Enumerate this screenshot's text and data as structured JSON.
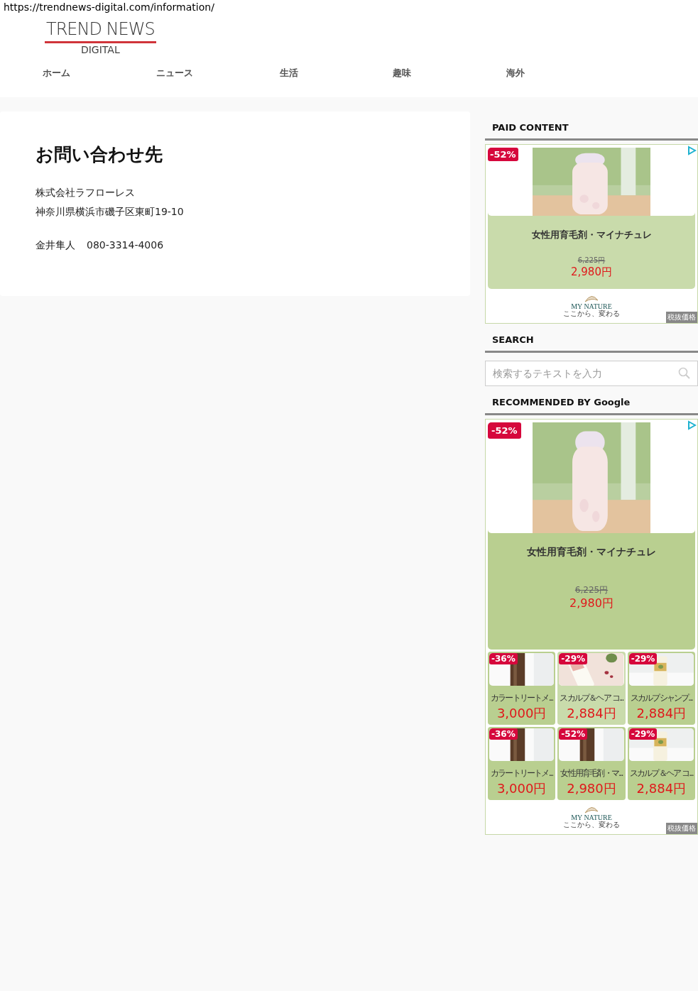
{
  "url": "https://trendnews-digital.com/information/",
  "logo": {
    "title": "TREND NEWS",
    "subtitle": "DIGITAL"
  },
  "nav": [
    {
      "label": "ホーム"
    },
    {
      "label": "ニュース"
    },
    {
      "label": "生活"
    },
    {
      "label": "趣味"
    },
    {
      "label": "海外"
    }
  ],
  "article": {
    "title": "お問い合わせ先",
    "address_lines": [
      "株式会社ラフローレス",
      "神奈川県横浜市磯子区東町19-10"
    ],
    "contact_name": "金井隼人",
    "contact_phone": "080-3314-4006"
  },
  "sidebar": [
    {
      "kind": "ad",
      "heading": "PAID CONTENT",
      "featured": {
        "discount": "-52%",
        "name": "女性用育毛剤・マイナチュレ",
        "old_price": "6,225円",
        "price": "2,980円"
      },
      "brand": {
        "name": "MY NATURE",
        "tagline": "ここから、変わる"
      },
      "tax_label": "税抜価格"
    },
    {
      "kind": "search",
      "heading": "SEARCH",
      "placeholder": "検索するテキストを入力"
    },
    {
      "kind": "ad",
      "heading": "RECOMMENDED BY Google",
      "featured": {
        "discount": "-52%",
        "name": "女性用育毛剤・マイナチュレ",
        "old_price": "6,225円",
        "price": "2,980円"
      },
      "items": [
        {
          "discount": "-36%",
          "name": "カラートリートメ...",
          "price": "3,000円"
        },
        {
          "discount": "-29%",
          "name": "スカルプ＆ヘア コ...",
          "price": "2,884円"
        },
        {
          "discount": "-29%",
          "name": "スカルプシャンプ...",
          "price": "2,884円"
        },
        {
          "discount": "-36%",
          "name": "カラートリートメ...",
          "price": "3,000円"
        },
        {
          "discount": "-52%",
          "name": "女性用育毛剤・マ...",
          "price": "2,980円"
        },
        {
          "discount": "-29%",
          "name": "スカルプ＆ヘア コ...",
          "price": "2,884円"
        }
      ],
      "brand": {
        "name": "MY NATURE",
        "tagline": "ここから、変わる"
      },
      "tax_label": "税抜価格"
    }
  ]
}
